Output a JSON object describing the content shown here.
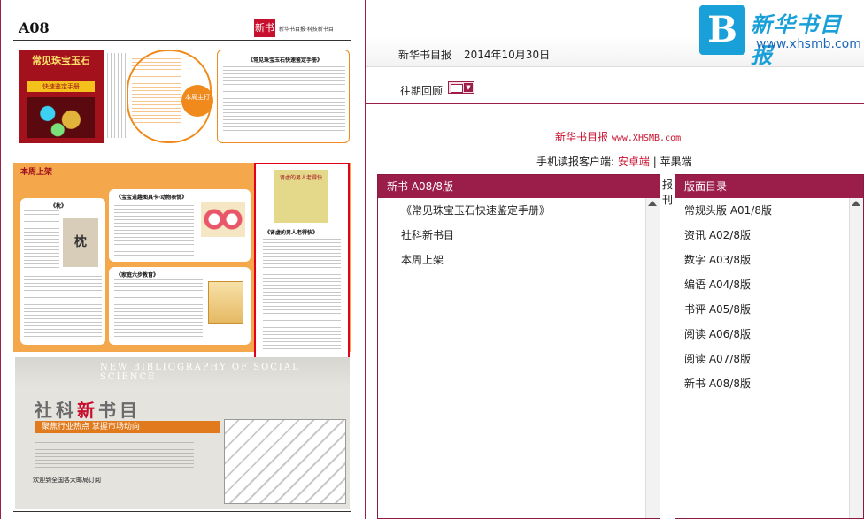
{
  "newspaper": {
    "page_number": "A08",
    "section_tag": "新书",
    "tagline": "新华书目报·科技新书目",
    "top_article_title": "《常见珠宝玉石快速鉴定手册》",
    "cover1_title": "常见珠宝玉石",
    "cover1_subtitle": "快速鉴定手册",
    "badge": "本周主打",
    "mid_label": "本周上架",
    "card1_title": "《枕》",
    "card1_cover": "枕",
    "card2_title": "《宝宝道趣图具卡·动物表情》",
    "card3_title": "《家庭六步教育》",
    "card4_cover": "肾虚的男人老得快",
    "card4_title": "《肾虚的男人老得快》",
    "ad_english": "NEW BIBLIOGRAPHY OF SOCIAL SCIENCE",
    "ad_title_a": "社科",
    "ad_title_b": "新",
    "ad_title_c": "书目",
    "ad_banner": "聚焦行业热点 掌握市场动向",
    "ad_order": "欢迎到全国各大邮局订阅"
  },
  "logo": {
    "mark": "B",
    "name": "新华书目报",
    "url": "www.xhsmb.com"
  },
  "header": {
    "title": "新华书目报",
    "date": "2014年10月30日"
  },
  "back_issues": {
    "label": "往期回顾"
  },
  "site": {
    "name": "新华书目报",
    "url": "www.XHSMB.com"
  },
  "client": {
    "prefix": "手机读报客户端:",
    "android": "安卓端",
    "separator": "|",
    "apple": "苹果端"
  },
  "gap_text": "报刊",
  "left_panel": {
    "header": "新书 A08/8版",
    "items": [
      {
        "label": "《常见珠宝玉石快速鉴定手册》"
      },
      {
        "label": "社科新书目"
      },
      {
        "label": "本周上架"
      }
    ]
  },
  "right_panel": {
    "header": "版面目录",
    "items": [
      {
        "label": "常规头版 A01/8版"
      },
      {
        "label": "资讯 A02/8版"
      },
      {
        "label": "数字 A03/8版"
      },
      {
        "label": "编语 A04/8版"
      },
      {
        "label": "书评 A05/8版"
      },
      {
        "label": "阅读 A06/8版"
      },
      {
        "label": "阅读 A07/8版"
      },
      {
        "label": "新书 A08/8版"
      }
    ]
  },
  "colors": {
    "accent": "#9b1d4a",
    "highlight": "#c8102e",
    "logo_blue": "#1aa0d8"
  }
}
